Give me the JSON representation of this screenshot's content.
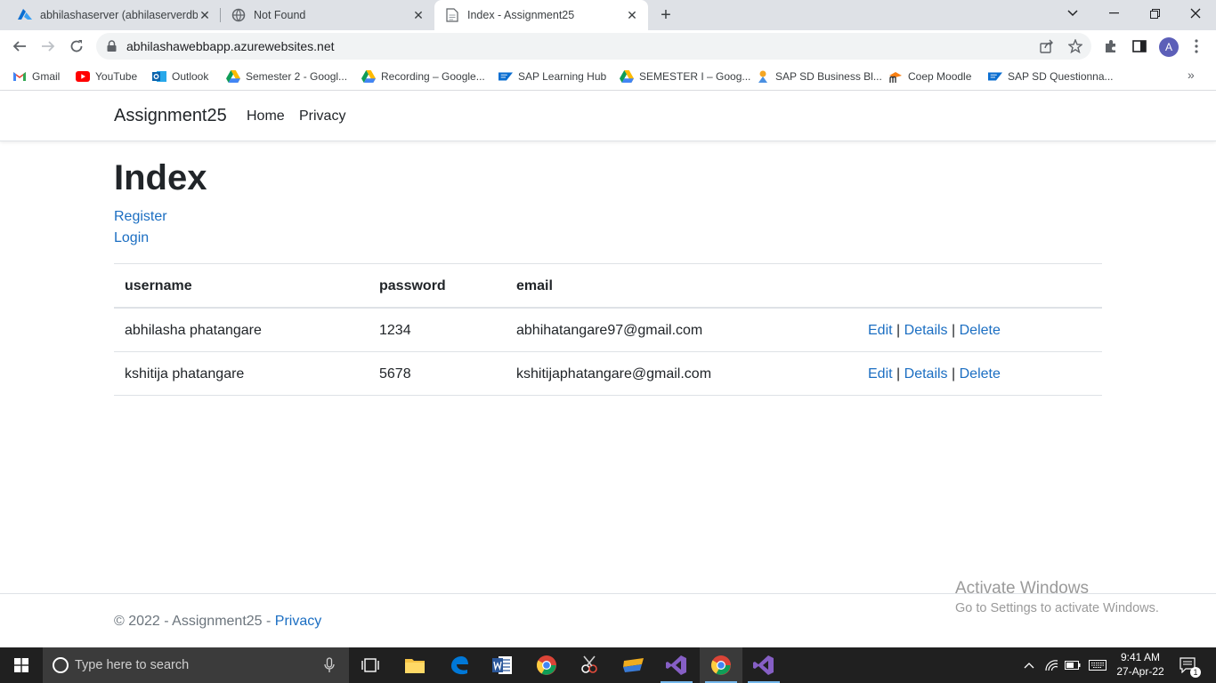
{
  "browser": {
    "tabs": [
      {
        "title": "abhilashaserver (abhilaserverdbserver)",
        "icon": "azure-icon",
        "active": false
      },
      {
        "title": "Not Found",
        "icon": "globe-icon",
        "active": false
      },
      {
        "title": "Index - Assignment25",
        "icon": "document-icon",
        "active": true
      }
    ],
    "url": "abhilashawebbapp.azurewebsites.net",
    "profile_initial": "A",
    "bookmarks": [
      {
        "label": "Gmail",
        "icon": "gmail-icon"
      },
      {
        "label": "YouTube",
        "icon": "youtube-icon"
      },
      {
        "label": "Outlook",
        "icon": "outlook-icon"
      },
      {
        "label": "Semester 2 - Googl...",
        "icon": "google-drive-icon"
      },
      {
        "label": "Recording – Google...",
        "icon": "google-drive-icon"
      },
      {
        "label": "SAP Learning Hub",
        "icon": "sap-icon"
      },
      {
        "label": "SEMESTER I – Goog...",
        "icon": "google-drive-icon"
      },
      {
        "label": "SAP SD Business Bl...",
        "icon": "blog-icon"
      },
      {
        "label": "Coep Moodle",
        "icon": "moodle-icon"
      },
      {
        "label": "SAP SD Questionna...",
        "icon": "sap-icon"
      }
    ]
  },
  "site": {
    "brand": "Assignment25",
    "nav": [
      "Home",
      "Privacy"
    ],
    "heading": "Index",
    "links": [
      "Register",
      "Login"
    ],
    "table": {
      "columns": [
        "username",
        "password",
        "email"
      ],
      "rows": [
        {
          "username": "abhilasha phatangare",
          "password": "1234",
          "email": "abhihatangare97@gmail.com"
        },
        {
          "username": "kshitija phatangare",
          "password": "5678",
          "email": "kshitijaphatangare@gmail.com"
        }
      ],
      "actions": {
        "edit": "Edit",
        "details": "Details",
        "delete": "Delete",
        "separator": "|"
      }
    },
    "footer": {
      "text": "© 2022 - Assignment25 - ",
      "link": "Privacy"
    }
  },
  "watermark": {
    "line1": "Activate Windows",
    "line2": "Go to Settings to activate Windows."
  },
  "taskbar": {
    "search_placeholder": "Type here to search",
    "time": "9:41 AM",
    "date": "27-Apr-22",
    "notification_count": "1"
  },
  "colors": {
    "link": "#1b6ec2",
    "taskbar": "#202020",
    "tabstrip": "#dee1e6"
  }
}
